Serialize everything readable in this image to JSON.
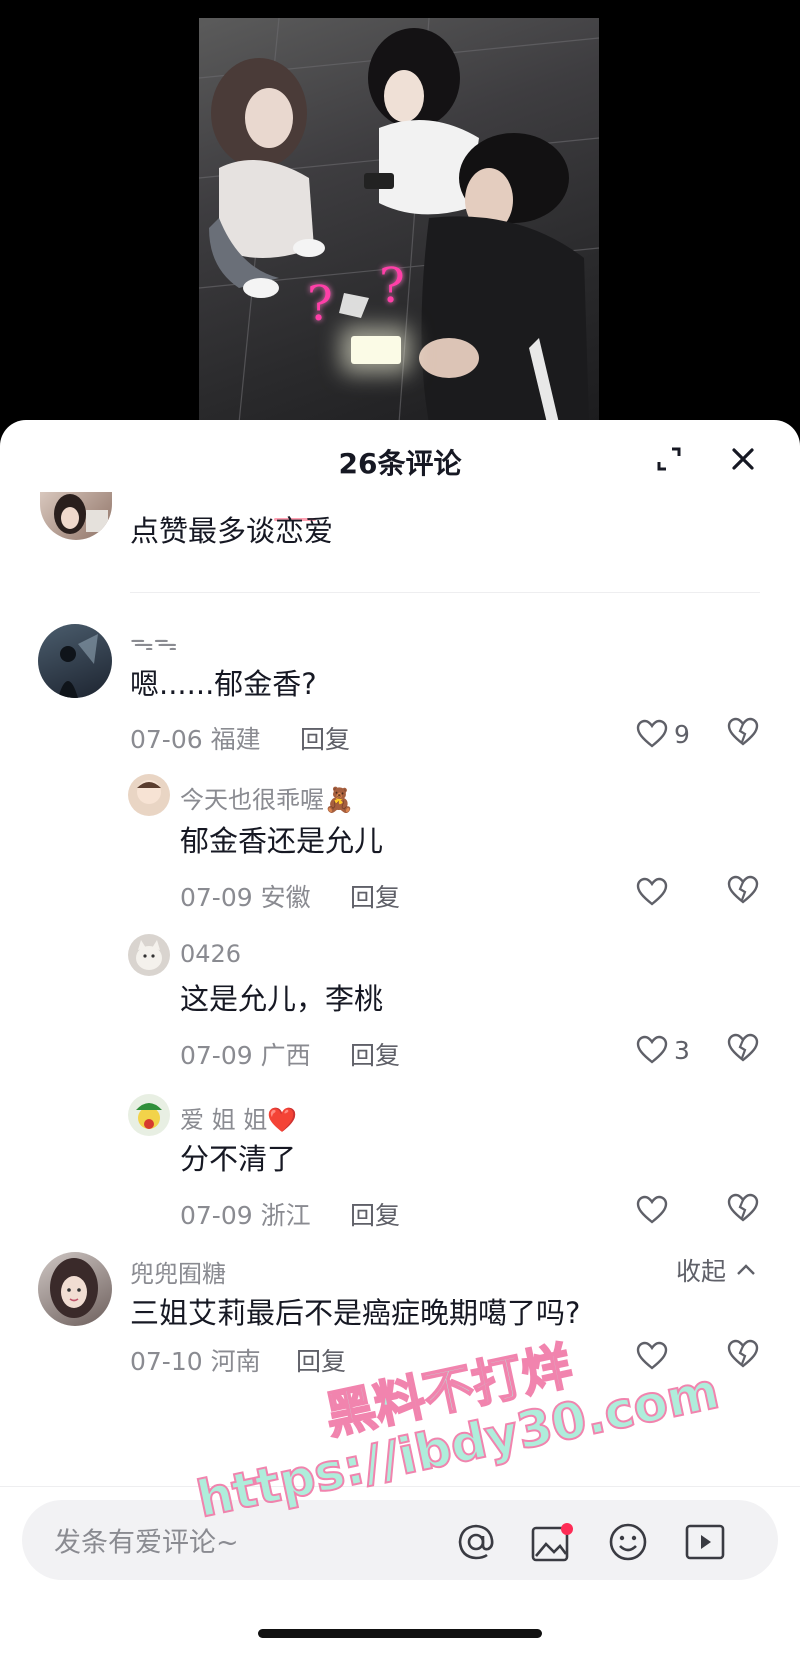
{
  "video": {
    "annotation_marks": [
      "?",
      "?"
    ]
  },
  "sheet": {
    "title": "26条评论",
    "expand_icon": "expand-icon",
    "close_icon": "close-icon"
  },
  "comments": [
    {
      "username": "",
      "text": "点赞最多谈恋爱",
      "date": "",
      "location": "",
      "reply_label": "",
      "likes": ""
    },
    {
      "username": "ᯓᯓ",
      "text": "嗯......郁金香?",
      "date": "07-06",
      "location": "福建",
      "reply_label": "回复",
      "likes": "9"
    },
    {
      "username": "今天也很乖喔🧸",
      "text": "郁金香还是允儿",
      "date": "07-09",
      "location": "安徽",
      "reply_label": "回复",
      "likes": ""
    },
    {
      "username": "0426",
      "text": "这是允儿，李桃",
      "date": "07-09",
      "location": "广西",
      "reply_label": "回复",
      "likes": "3"
    },
    {
      "username": "爱 姐 姐❤️",
      "text": "分不清了",
      "date": "07-09",
      "location": "浙江",
      "reply_label": "回复",
      "likes": ""
    },
    {
      "username": "兜兜囿糖",
      "text": "三姐艾莉最后不是癌症晚期噶了吗?",
      "date": "07-10",
      "location": "河南",
      "reply_label": "回复",
      "likes": ""
    }
  ],
  "collapse_label": "收起",
  "input": {
    "placeholder": "发条有爱评论~",
    "icons": [
      "at-icon",
      "image-icon",
      "emoji-icon",
      "video-icon"
    ]
  },
  "watermark": {
    "line1": "黑料不打烊",
    "line2": "https://ibdy30.com"
  },
  "colors": {
    "accent": "#fe2c55",
    "text": "#161823",
    "secondary": "#8a8b91",
    "watermark_fill": "#a9ecd9",
    "watermark_stroke": "#f07aa8"
  }
}
